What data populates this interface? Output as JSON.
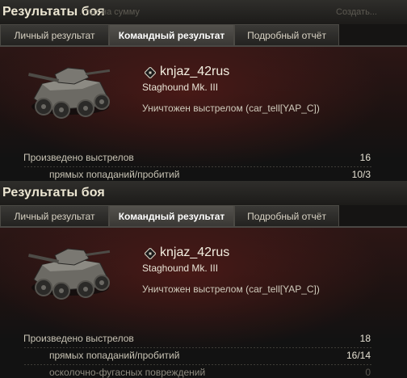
{
  "panels": [
    {
      "window_title": "Результаты боя",
      "ghost_left": "...тат на сумму",
      "ghost_right": "Создать...",
      "tabs": [
        {
          "label": "Личный результат",
          "active": false
        },
        {
          "label": "Командный результат",
          "active": true
        },
        {
          "label": "Подробный отчёт",
          "active": false
        }
      ],
      "player": {
        "name": "knjaz_42rus",
        "vehicle": "Staghound Mk. III",
        "status": "Уничтожен выстрелом (car_tell[YAP_C])"
      },
      "stats": [
        {
          "label": "Произведено выстрелов",
          "value": "16",
          "sub": false
        },
        {
          "label": "прямых попаданий/пробитий",
          "value": "10/3",
          "sub": true
        }
      ]
    },
    {
      "window_title": "Результаты боя",
      "tabs": [
        {
          "label": "Личный результат",
          "active": false
        },
        {
          "label": "Командный результат",
          "active": true
        },
        {
          "label": "Подробный отчёт",
          "active": false
        }
      ],
      "player": {
        "name": "knjaz_42rus",
        "vehicle": "Staghound Mk. III",
        "status": "Уничтожен выстрелом (car_tell[YAP_C])"
      },
      "stats": [
        {
          "label": "Произведено выстрелов",
          "value": "18",
          "sub": false
        },
        {
          "label": "прямых попаданий/пробитий",
          "value": "16/14",
          "sub": true
        },
        {
          "label": "осколочно-фугасных повреждений",
          "value": "0",
          "sub": true
        }
      ]
    }
  ],
  "icons": {
    "clan": "clan-emblem-icon",
    "tank": "armored-car-image"
  },
  "colors": {
    "accent_red": "#6a1f1b",
    "text_light": "#ece6d2",
    "text_dim": "#5a5750"
  }
}
